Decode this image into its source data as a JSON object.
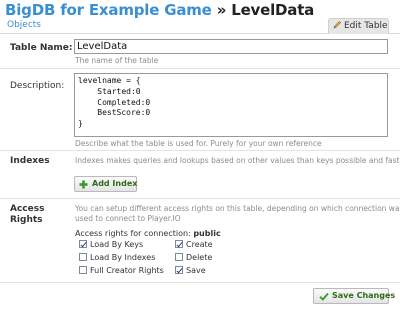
{
  "header": {
    "title_prefix": "BigDB for Example Game",
    "separator": "»",
    "title_table": "LevelData"
  },
  "tabs": {
    "objects": "Objects",
    "edit_table": "Edit Table"
  },
  "table_name": {
    "label": "Table Name:",
    "value": "LevelData",
    "hint": "The name of the table"
  },
  "description": {
    "label": "Description:",
    "value": "levelname = {\n    Started:0\n    Completed:0\n    BestScore:0\n}",
    "hint": "Describe what the table is used for. Purely for your own reference"
  },
  "indexes": {
    "label": "Indexes",
    "hint": "Indexes makes queries and lookups based on other values than keys possible and fast.",
    "add_button": "Add Index"
  },
  "access_rights": {
    "label_line1": "Access",
    "label_line2": "Rights",
    "hint_line1": "You can setup different access rights on this table, depending on which connection was",
    "hint_line2": "used to connect to Player.IO",
    "connection_prefix": "Access rights for connection:",
    "connection_name": "public",
    "checkboxes": [
      {
        "label": "Load By Keys",
        "checked": true
      },
      {
        "label": "Create",
        "checked": true
      },
      {
        "label": "Load By Indexes",
        "checked": false
      },
      {
        "label": "Delete",
        "checked": false
      },
      {
        "label": "Full Creator Rights",
        "checked": false
      },
      {
        "label": "Save",
        "checked": true
      }
    ]
  },
  "footer": {
    "save_button": "Save Changes"
  },
  "colors": {
    "title_blue": "#3a8fd1",
    "hint_gray": "#8c8c8c",
    "button_text_green": "#2e6b1a"
  }
}
